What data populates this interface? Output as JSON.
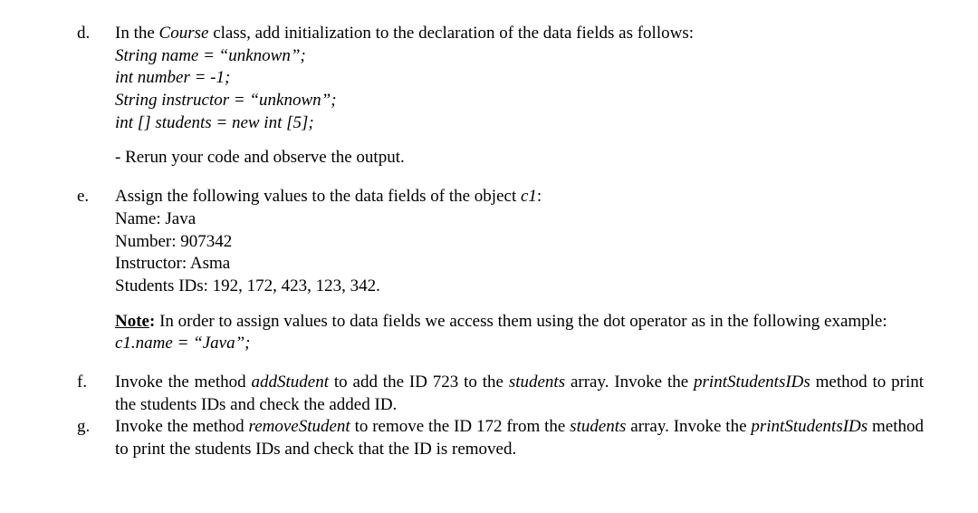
{
  "items": {
    "d": {
      "marker": "d.",
      "intro_before": "In the ",
      "intro_course": "Course",
      "intro_after": " class, add initialization to the declaration of the data fields as follows:",
      "code1": "String name = “unknown”;",
      "code2": "int number = -1;",
      "code3": "String instructor = “unknown”;",
      "code4": "int [] students = new int [5];",
      "rerun": "- Rerun your code and observe the output."
    },
    "e": {
      "marker": "e.",
      "intro_before": "Assign the following values to the data fields of the object ",
      "intro_c1": "c1",
      "intro_after": ":",
      "line_name": "Name: Java",
      "line_number": "Number: 907342",
      "line_instructor": "Instructor: Asma",
      "line_students": "Students IDs: 192, 172, 423, 123, 342.",
      "note_label": "Note",
      "note_colon": ":",
      "note_text": " In order to assign values to data fields we access them using the dot operator as in the following example:",
      "note_code": "c1.name = “Java”;"
    },
    "f": {
      "marker": "f.",
      "p1": "Invoke the method ",
      "addStudent": "addStudent",
      "p2": " to add the ID 723 to the ",
      "students": "students",
      "p3": " array. Invoke the ",
      "printStudentsIDs": "printStudentsIDs",
      "p4": " method to print the students IDs and check the added ID."
    },
    "g": {
      "marker": "g.",
      "p1": "Invoke the method ",
      "removeStudent": "removeStudent",
      "p2": " to remove the ID 172 from the ",
      "students": "students",
      "p3": " array. Invoke the ",
      "printStudentsIDs": "printStudentsIDs",
      "p4": " method to print the students IDs and check that the ID is removed."
    }
  }
}
